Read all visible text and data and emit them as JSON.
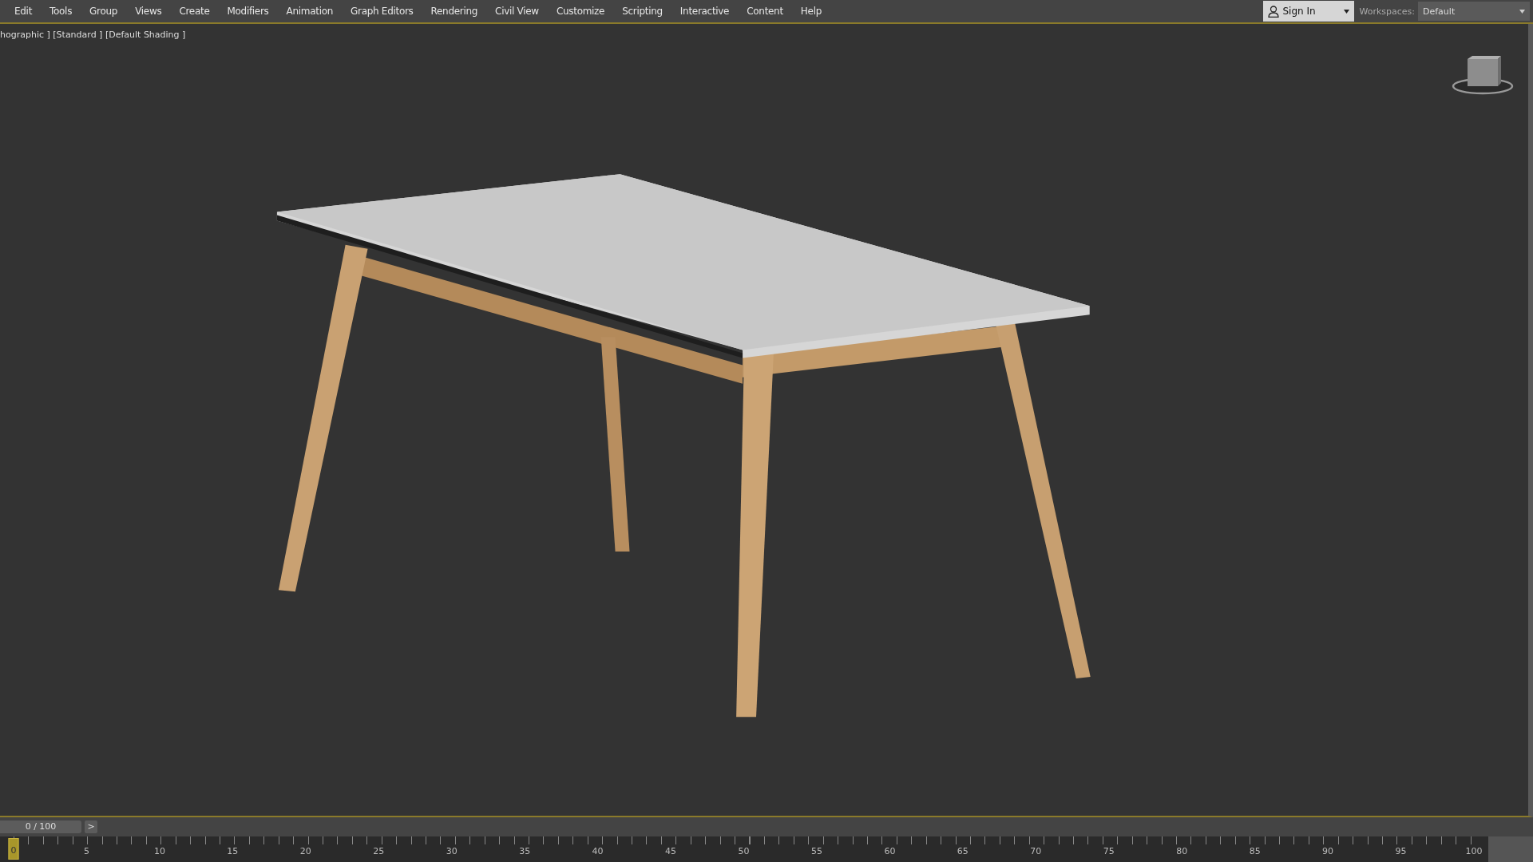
{
  "menu_bar": {
    "items": [
      "Edit",
      "Tools",
      "Group",
      "Views",
      "Create",
      "Modifiers",
      "Animation",
      "Graph Editors",
      "Rendering",
      "Civil View",
      "Customize",
      "Scripting",
      "Interactive",
      "Content",
      "Help"
    ],
    "sign_in": {
      "label": "Sign In"
    },
    "workspaces": {
      "label": "Workspaces:",
      "value": "Default"
    }
  },
  "viewport": {
    "label": "hographic ] [Standard ] [Default Shading ]"
  },
  "timeline": {
    "time_slider": {
      "label": "0 / 100",
      "next": ">",
      "level": 0
    },
    "ruler": {
      "ticks": [
        {
          "label": "0",
          "selected": true
        },
        {
          "label": "5",
          "selected": false
        },
        {
          "label": "10",
          "selected": false
        },
        {
          "label": "15",
          "selected": false
        },
        {
          "label": "20",
          "selected": false
        },
        {
          "label": "25",
          "selected": false
        },
        {
          "label": "30",
          "selected": false
        },
        {
          "label": "35",
          "selected": false
        },
        {
          "label": "40",
          "selected": false
        },
        {
          "label": "45",
          "selected": false
        },
        {
          "label": "50",
          "selected": false
        },
        {
          "label": "55",
          "selected": false
        },
        {
          "label": "60",
          "selected": false
        },
        {
          "label": "65",
          "selected": false
        },
        {
          "label": "70",
          "selected": false
        },
        {
          "label": "75",
          "selected": false
        },
        {
          "label": "80",
          "selected": false
        },
        {
          "label": "85",
          "selected": false
        },
        {
          "label": "90",
          "selected": false
        },
        {
          "label": "95",
          "selected": false
        },
        {
          "label": "100",
          "selected": false
        }
      ]
    }
  }
}
